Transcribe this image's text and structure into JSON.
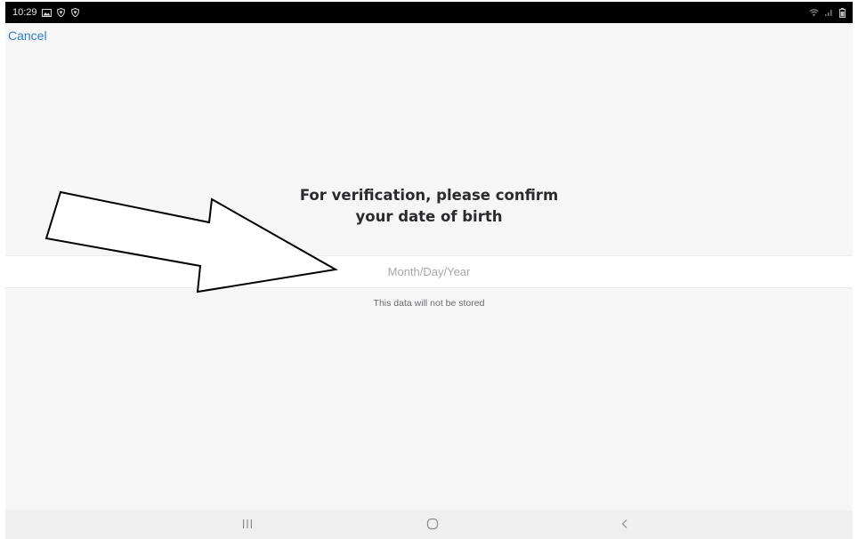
{
  "status_bar": {
    "time": "10:29",
    "icons_left": [
      "image-icon",
      "shield-icon",
      "shield-icon"
    ],
    "icons_right": [
      "wifi-icon",
      "signal-icon",
      "battery-icon"
    ]
  },
  "header": {
    "cancel_label": "Cancel"
  },
  "prompt": {
    "title_line1": "For verification, please confirm",
    "title_line2": "your date of birth"
  },
  "dob_field": {
    "placeholder": "Month/Day/Year",
    "value": ""
  },
  "hint": {
    "text": "This data will not be stored"
  },
  "nav_bar": {
    "buttons": [
      "recents-icon",
      "home-icon",
      "back-icon"
    ]
  },
  "colors": {
    "accent": "#2f7fc1",
    "background": "#f6f6f7",
    "title_text": "#2b2b2d",
    "placeholder": "#a8a8aa",
    "status_bar": "#000000"
  }
}
